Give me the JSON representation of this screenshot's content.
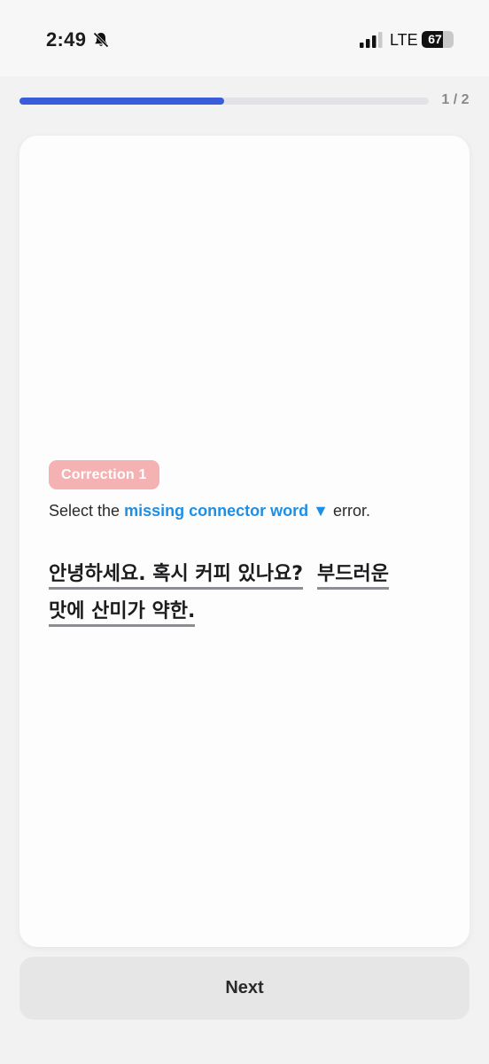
{
  "status_bar": {
    "time": "2:49",
    "network": "LTE",
    "battery_percent": "67",
    "battery_level": 0.67
  },
  "progress": {
    "count": "1 / 2",
    "fraction": 0.5,
    "fill_color": "#3a5cd8"
  },
  "card": {
    "badge": "Correction 1",
    "badge_color": "#f4b2b2",
    "instruction": {
      "prefix": "Select the",
      "highlight": "missing connector word",
      "arrow": "▼",
      "suffix": "error.",
      "highlight_color": "#1e8fe6"
    },
    "segments": [
      "안녕하세요. 혹시 커피 있나요?",
      "부드러운",
      "맛에 산미가 약한."
    ]
  },
  "footer": {
    "next_label": "Next"
  },
  "icons": [
    "mute-bell-icon",
    "signal-icon",
    "battery-icon",
    "chevron-down-icon"
  ]
}
